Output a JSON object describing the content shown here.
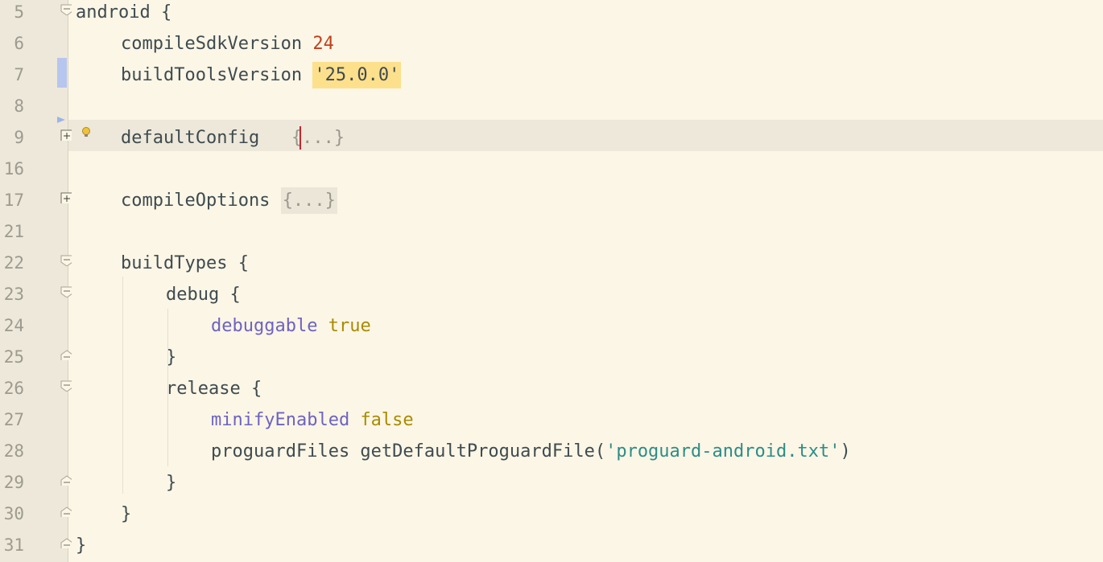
{
  "editor": {
    "lines": [
      {
        "num": "5",
        "tokens": [
          {
            "t": "android {",
            "c": "plain"
          }
        ]
      },
      {
        "num": "6",
        "tokens": [
          {
            "t": "compileSdkVersion ",
            "c": "plain"
          },
          {
            "t": "24",
            "c": "num"
          }
        ]
      },
      {
        "num": "7",
        "tokens": [
          {
            "t": "buildToolsVersion ",
            "c": "plain"
          },
          {
            "t": "'25.0.0'",
            "c": "str-hl"
          }
        ]
      },
      {
        "num": "8",
        "tokens": []
      },
      {
        "num": "9",
        "tokens": [
          {
            "t": "defaultConfig   ",
            "c": "plain"
          },
          {
            "t": "{...}",
            "c": "fold"
          }
        ]
      },
      {
        "num": "16",
        "tokens": []
      },
      {
        "num": "17",
        "tokens": [
          {
            "t": "compileOptions ",
            "c": "plain"
          },
          {
            "t": "{...}",
            "c": "fold-box"
          }
        ]
      },
      {
        "num": "21",
        "tokens": []
      },
      {
        "num": "22",
        "tokens": [
          {
            "t": "buildTypes {",
            "c": "plain"
          }
        ]
      },
      {
        "num": "23",
        "tokens": [
          {
            "t": "debug {",
            "c": "plain"
          }
        ]
      },
      {
        "num": "24",
        "tokens": [
          {
            "t": "debuggable",
            "c": "prop"
          },
          {
            "t": " ",
            "c": "plain"
          },
          {
            "t": "true",
            "c": "kw"
          }
        ]
      },
      {
        "num": "25",
        "tokens": [
          {
            "t": "}",
            "c": "plain"
          }
        ]
      },
      {
        "num": "26",
        "tokens": [
          {
            "t": "release {",
            "c": "plain"
          }
        ]
      },
      {
        "num": "27",
        "tokens": [
          {
            "t": "minifyEnabled",
            "c": "prop"
          },
          {
            "t": " ",
            "c": "plain"
          },
          {
            "t": "false",
            "c": "kw"
          }
        ]
      },
      {
        "num": "28",
        "tokens": [
          {
            "t": "proguardFiles getDefaultProguardFile(",
            "c": "plain"
          },
          {
            "t": "'proguard-android.txt'",
            "c": "str"
          },
          {
            "t": ")",
            "c": "plain"
          }
        ]
      },
      {
        "num": "29",
        "tokens": [
          {
            "t": "}",
            "c": "plain"
          }
        ]
      },
      {
        "num": "30",
        "tokens": [
          {
            "t": "}",
            "c": "plain"
          }
        ]
      },
      {
        "num": "31",
        "tokens": [
          {
            "t": "}",
            "c": "plain"
          }
        ]
      }
    ]
  },
  "colors": {
    "background": "#fbf6e6",
    "gutter": "#ede8da",
    "number": "#c0401c",
    "string": "#2d8c86",
    "keyword": "#a88b00",
    "property": "#6e63c0",
    "caret": "#c6252e"
  },
  "icons": [
    "fold-collapse-icon",
    "fold-expand-icon",
    "fold-end-icon",
    "lightbulb-icon",
    "bookmark-arrow-icon"
  ]
}
